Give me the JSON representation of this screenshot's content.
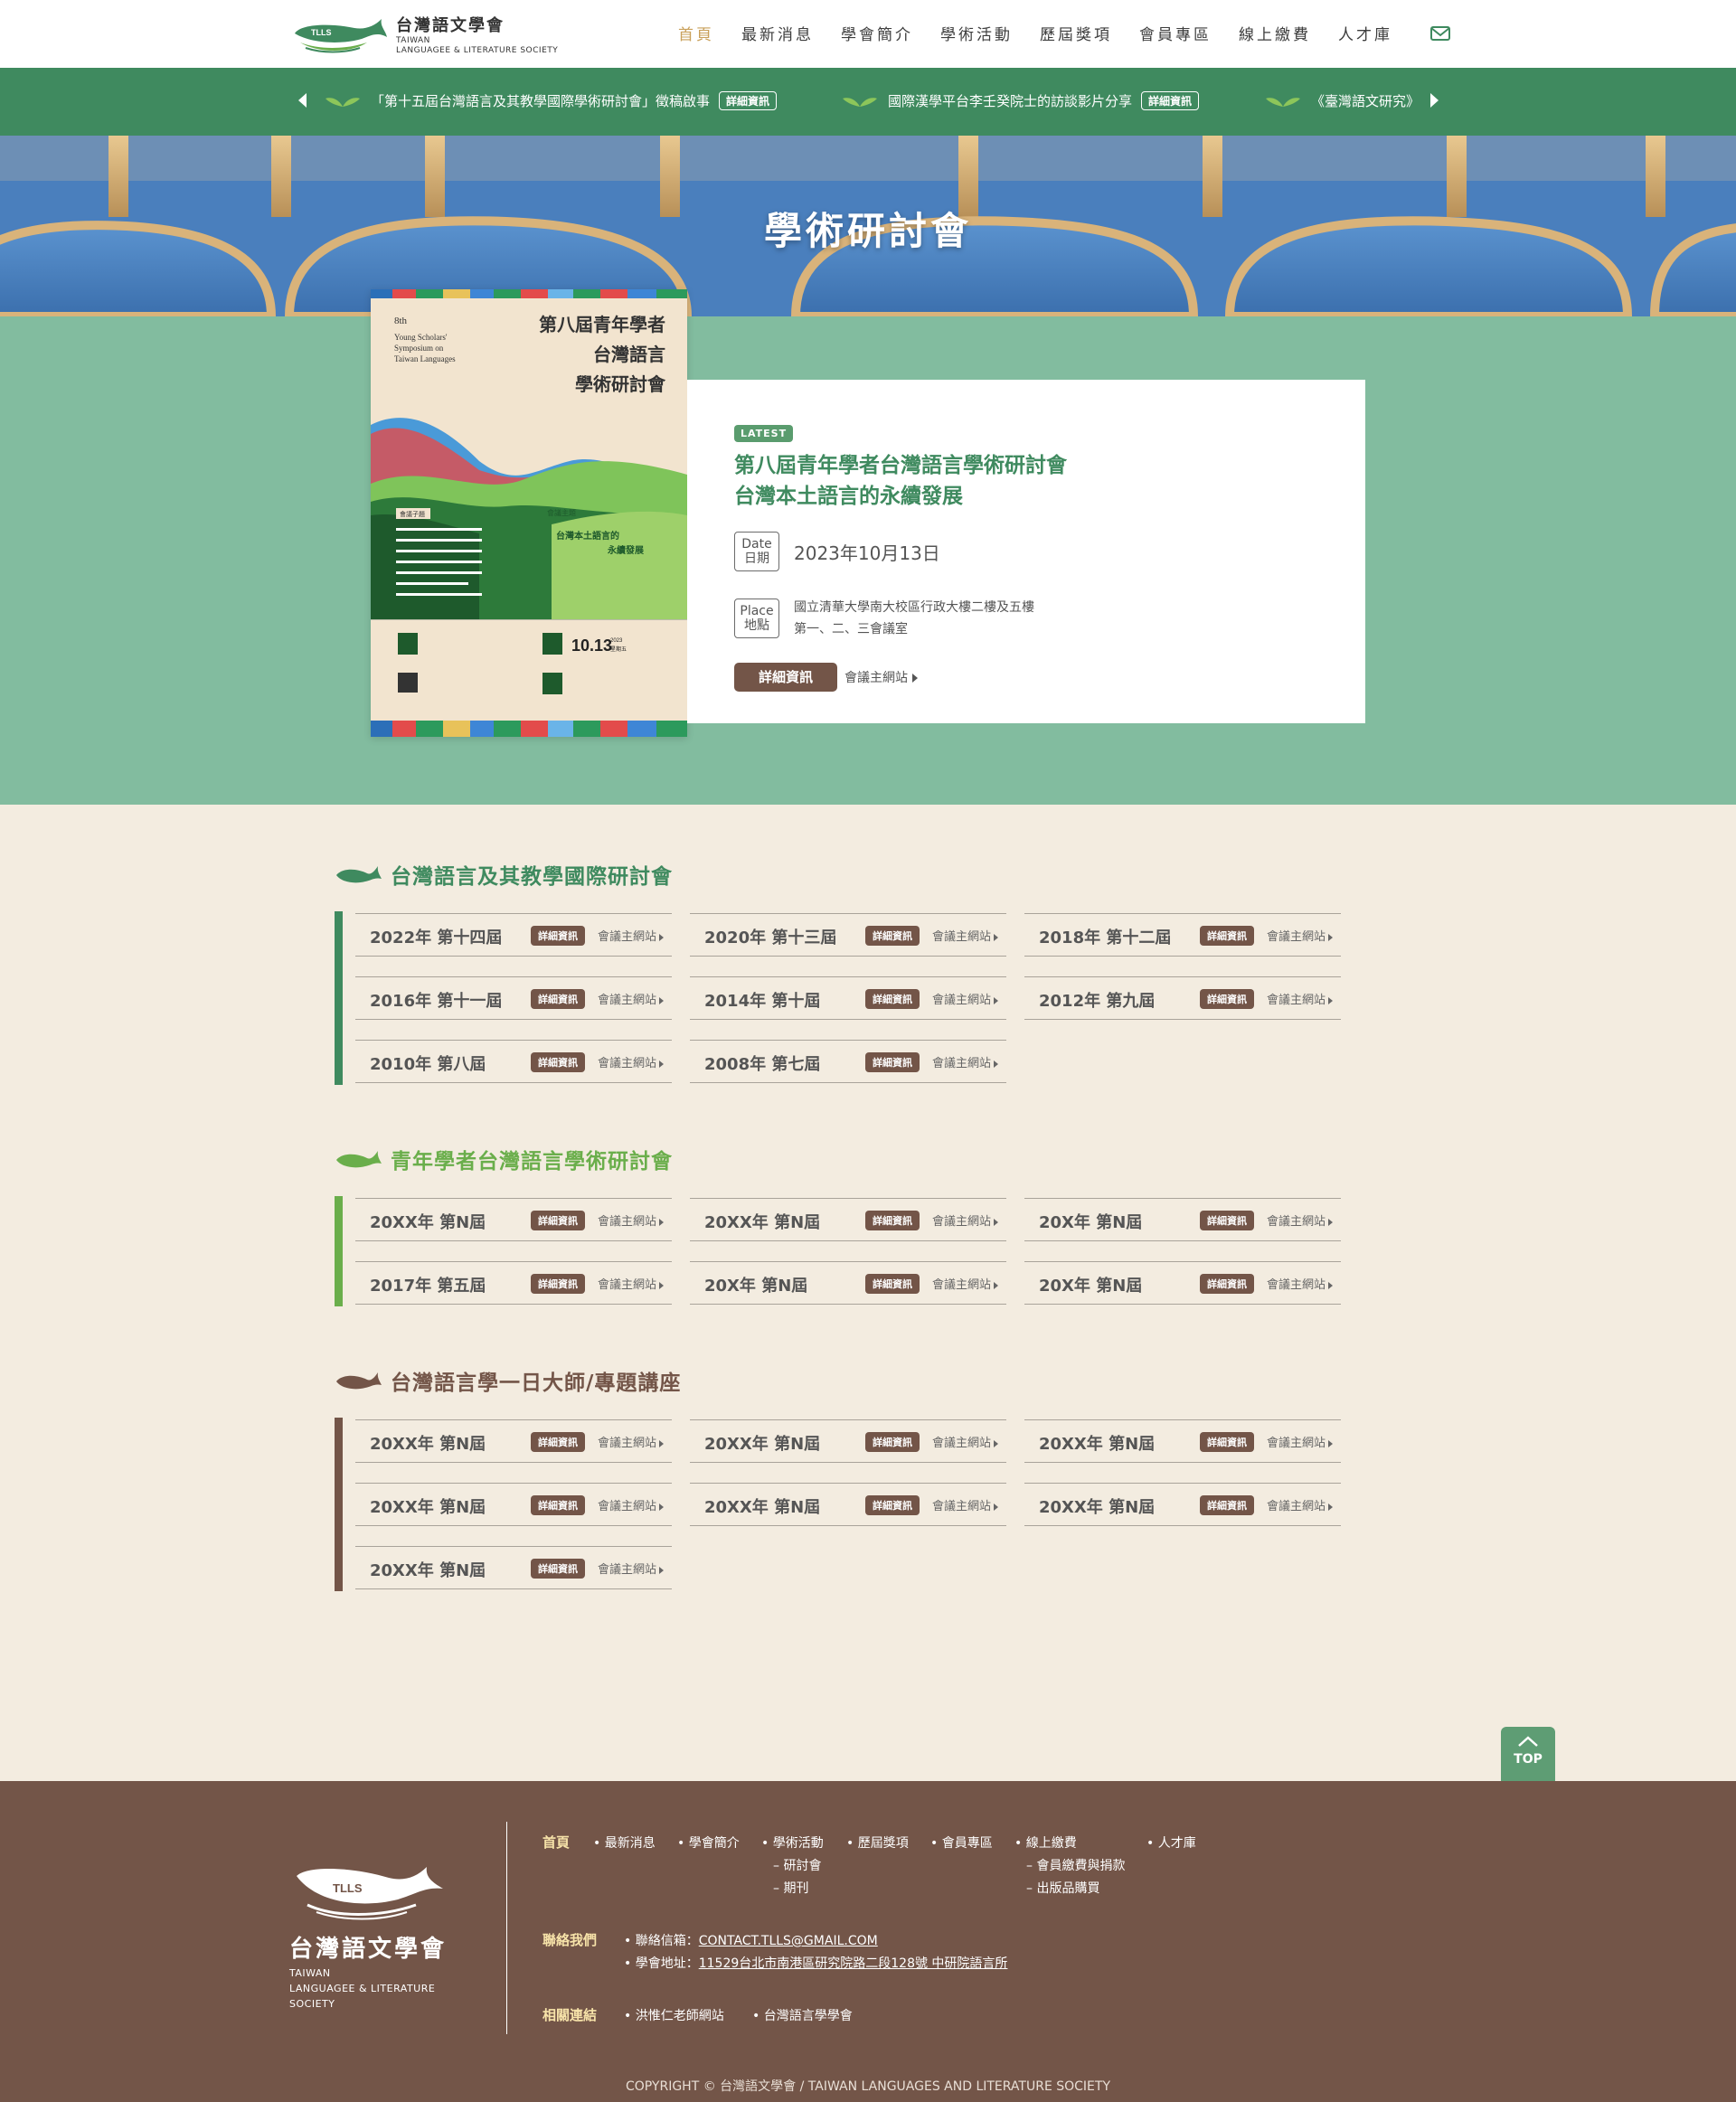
{
  "header": {
    "logo_zh": "台灣語文學會",
    "logo_en_1": "TAIWAN",
    "logo_en_2": "LANGUAGEE & LITERATURE SOCIETY",
    "logo_mark_text": "TLLS",
    "nav": [
      "首頁",
      "最新消息",
      "學會簡介",
      "學術活動",
      "歷屆獎項",
      "會員專區",
      "線上繳費",
      "人才庫"
    ],
    "mail_icon": "mail-icon"
  },
  "ticker": {
    "items": [
      {
        "text": "「第十五屆台灣語言及其教學國際學術研討會」徵稿啟事",
        "badge": "詳細資訊"
      },
      {
        "text": "國際漢學平台李壬癸院士的訪談影片分享",
        "badge": "詳細資訊"
      },
      {
        "text": "《臺灣語文研究》"
      }
    ]
  },
  "hero": {
    "title": "學術研討會"
  },
  "poster": {
    "num": "8th",
    "en": [
      "Young Scholars'",
      "Symposium on",
      "Taiwan Languages"
    ],
    "zh": [
      "第八屆青年學者",
      "台灣語言",
      "學術研討會"
    ],
    "theme_label": "會議主題",
    "theme": [
      "台灣本土語言的",
      "永續發展"
    ],
    "subtopic_label": "會議子題",
    "date": "10.13",
    "year": "2023",
    "weekday": "星期五"
  },
  "latest": {
    "badge": "LATEST",
    "title_line1": "第八屆青年學者台灣語言學術研討會",
    "title_line2": "台灣本土語言的永續發展",
    "date_label_en": "Date",
    "date_label_zh": "日期",
    "date": "2023年10月13日",
    "place_label_en": "Place",
    "place_label_zh": "地點",
    "place_line1": "國立清華大學南大校區行政大樓二樓及五樓",
    "place_line2": "第一、二、三會議室",
    "detail_button": "詳細資訊",
    "site_link": "會議主網站"
  },
  "groups": [
    {
      "title": "台灣語言及其教學國際研討會",
      "color": "#3f8a5f",
      "items": [
        "2022年 第十四屆",
        "2020年 第十三屆",
        "2018年 第十二屆",
        "2016年 第十一屆",
        "2014年 第十屆",
        "2012年 第九屆",
        "2010年 第八屆",
        "2008年 第七屆"
      ]
    },
    {
      "title": "青年學者台灣語言學術研討會",
      "color": "#6aae4b",
      "items": [
        "20XX年 第N屆",
        "20XX年 第N屆",
        "20X年 第N屆",
        "2017年 第五屆",
        "20X年 第N屆",
        "20X年 第N屆"
      ]
    },
    {
      "title": "台灣語言學一日大師/專題講座",
      "color": "#735548",
      "items": [
        "20XX年 第N屆",
        "20XX年 第N屆",
        "20XX年 第N屆",
        "20XX年 第N屆",
        "20XX年 第N屆",
        "20XX年 第N屆",
        "20XX年 第N屆"
      ]
    }
  ],
  "item_badge": "詳細資訊",
  "item_site": "會議主網站",
  "top_button": "TOP",
  "footer": {
    "logo_mark_text": "TLLS",
    "logo_zh": "台灣語文學會",
    "logo_en": [
      "TAIWAN",
      "LANGUAGEE & LITERATURE",
      "SOCIETY"
    ],
    "nav_head": "首頁",
    "nav": [
      "最新消息",
      "學會簡介",
      "學術活動",
      "歷屆獎項",
      "會員專區",
      "線上繳費",
      "人才庫"
    ],
    "sub_activity": [
      "– 研討會",
      "– 期刊"
    ],
    "sub_payment": [
      "– 會員繳費與捐款",
      "– 出版品購買"
    ],
    "contact_head": "聯絡我們",
    "email_label": "聯絡信箱：",
    "email": "CONTACT.TLLS@GMAIL.COM",
    "address_label": "學會地址：",
    "address": "11529台北市南港區研究院路二段128號 中研院語言所",
    "links_head": "相關連結",
    "links": [
      "洪惟仁老師網站",
      "台灣語言學學會"
    ],
    "copyright": "COPYRIGHT © 台灣語文學會 / TAIWAN LANGUAGES AND LITERATURE SOCIETY"
  }
}
